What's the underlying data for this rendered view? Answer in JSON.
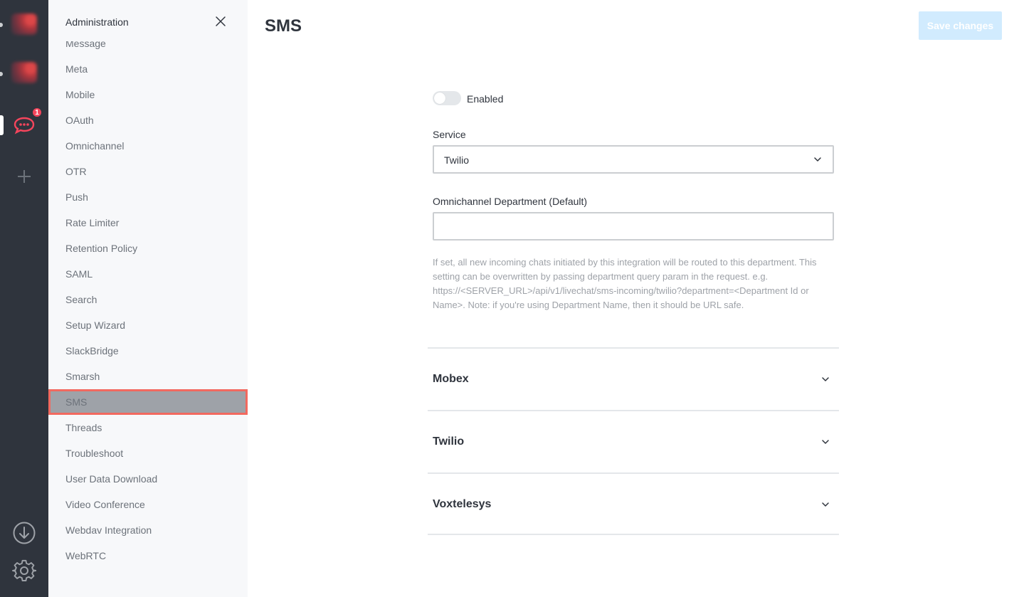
{
  "rail": {
    "badge_count": "1"
  },
  "sidebar": {
    "title": "Administration",
    "items": [
      {
        "label": "Message"
      },
      {
        "label": "Meta"
      },
      {
        "label": "Mobile"
      },
      {
        "label": "OAuth"
      },
      {
        "label": "Omnichannel"
      },
      {
        "label": "OTR"
      },
      {
        "label": "Push"
      },
      {
        "label": "Rate Limiter"
      },
      {
        "label": "Retention Policy"
      },
      {
        "label": "SAML"
      },
      {
        "label": "Search"
      },
      {
        "label": "Setup Wizard"
      },
      {
        "label": "SlackBridge"
      },
      {
        "label": "Smarsh"
      },
      {
        "label": "SMS"
      },
      {
        "label": "Threads"
      },
      {
        "label": "Troubleshoot"
      },
      {
        "label": "User Data Download"
      },
      {
        "label": "Video Conference"
      },
      {
        "label": "Webdav Integration"
      },
      {
        "label": "WebRTC"
      }
    ],
    "selected": "SMS"
  },
  "main": {
    "title": "SMS",
    "save_label": "Save changes",
    "enabled_label": "Enabled",
    "enabled": false,
    "service_label": "Service",
    "service_value": "Twilio",
    "department_label": "Omnichannel Department (Default)",
    "department_value": "",
    "department_hint": "If set, all new incoming chats initiated by this integration will be routed to this department. This setting can be overwritten by passing department query param in the request. e.g. https://<SERVER_URL>/api/v1/livechat/sms-incoming/twilio?department=<Department Id or Name>. Note: if you're using Department Name, then it should be URL safe.",
    "sections": [
      {
        "title": "Mobex"
      },
      {
        "title": "Twilio"
      },
      {
        "title": "Voxtelesys"
      }
    ]
  },
  "colors": {
    "rail_bg": "#2f343d",
    "sidebar_bg": "#f7f8fa",
    "highlight_outline": "#f2695f",
    "badge": "#f5455c",
    "save_disabled": "#d1ebfe"
  }
}
